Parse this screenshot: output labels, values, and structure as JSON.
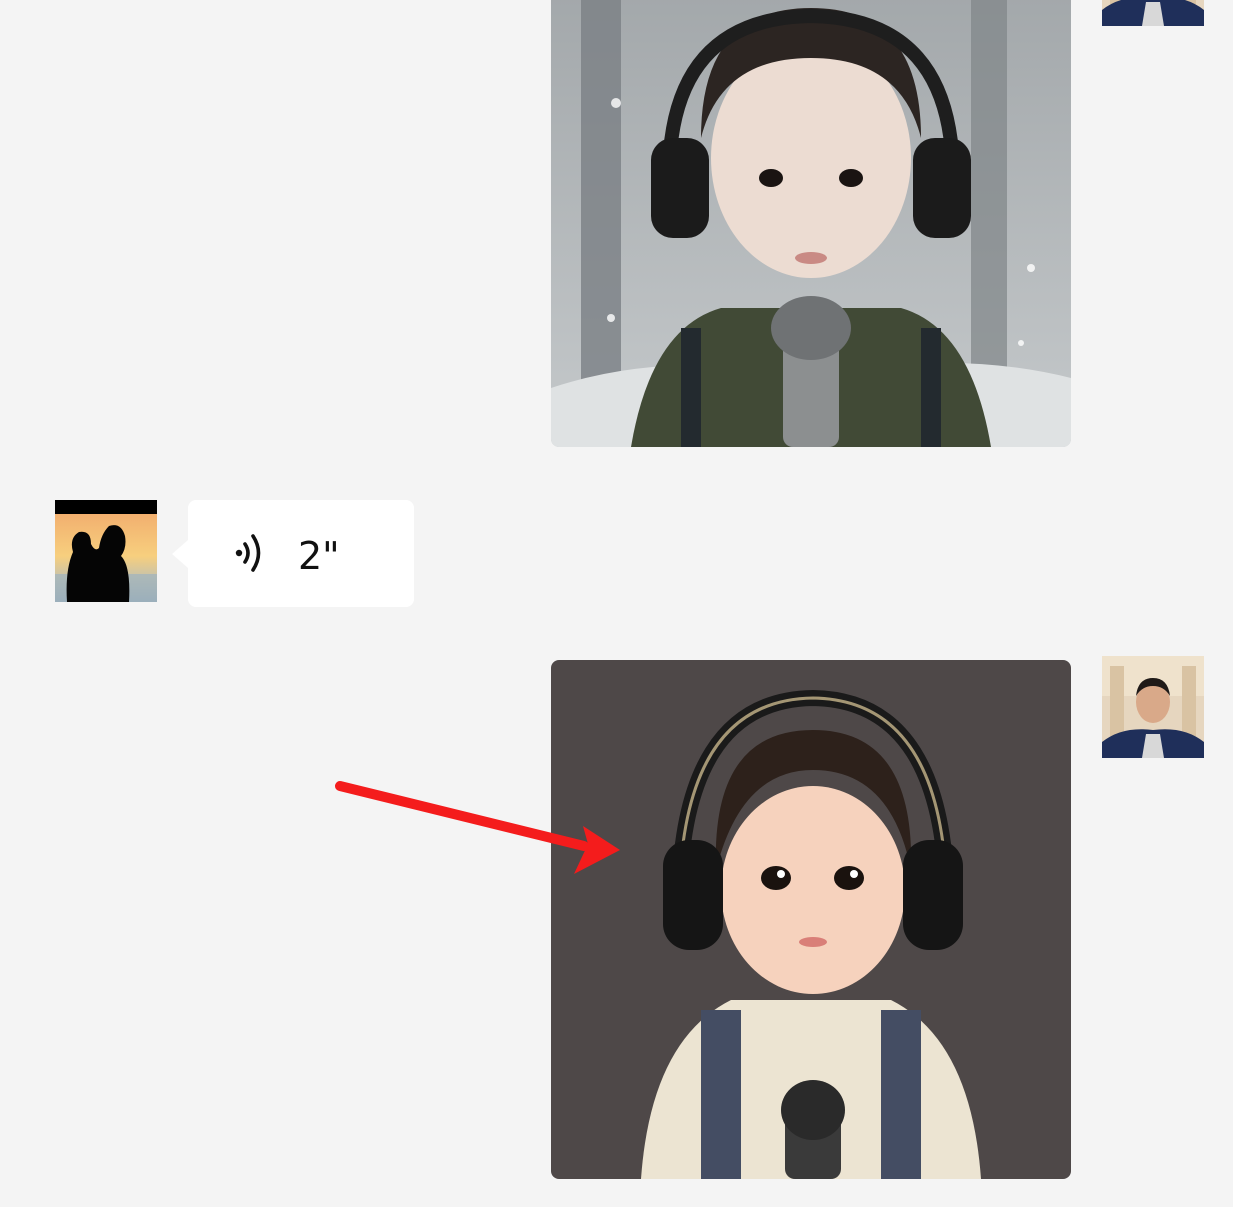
{
  "chat": {
    "messages": [
      {
        "type": "image",
        "sender": "self",
        "content": "boy-with-headphones-photo"
      },
      {
        "type": "voice",
        "sender": "contact",
        "duration": "2\"",
        "icon": "voice-wave-icon"
      },
      {
        "type": "image",
        "sender": "self",
        "content": "boy-with-headphones-illustration"
      }
    ]
  },
  "colors": {
    "background": "#f4f4f4",
    "bubble": "#ffffff",
    "arrow": "#f41c1c"
  }
}
